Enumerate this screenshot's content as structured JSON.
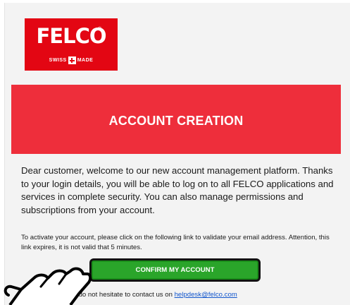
{
  "logo": {
    "word": "FELCO",
    "registered": "®",
    "tagline_left": "SWISS",
    "tagline_right": "MADE"
  },
  "hero": {
    "title": "ACCOUNT CREATION"
  },
  "body": {
    "intro": "Dear customer, welcome to our new account management platform. Thanks to your login details, you will be able to log on to all FELCO applications and services in complete security. You can also manage permissions and subscriptions from your account.",
    "activate": "To activate your account, please click on the following link to validate your email address. Attention, this link expires, it is not valid that 5 minutes.",
    "contact_prefix": "For any questions, do not hesitate to contact us on ",
    "contact_email": "helpdesk@felco.com"
  },
  "button": {
    "confirm_label": "CONFIRM MY ACCOUNT"
  },
  "colors": {
    "brand_red": "#e30613",
    "hero_red": "#ee2e3b",
    "button_green": "#2aa52a",
    "link_blue": "#1155cc"
  },
  "icons": {
    "cursor": "hand-pointer-icon"
  }
}
